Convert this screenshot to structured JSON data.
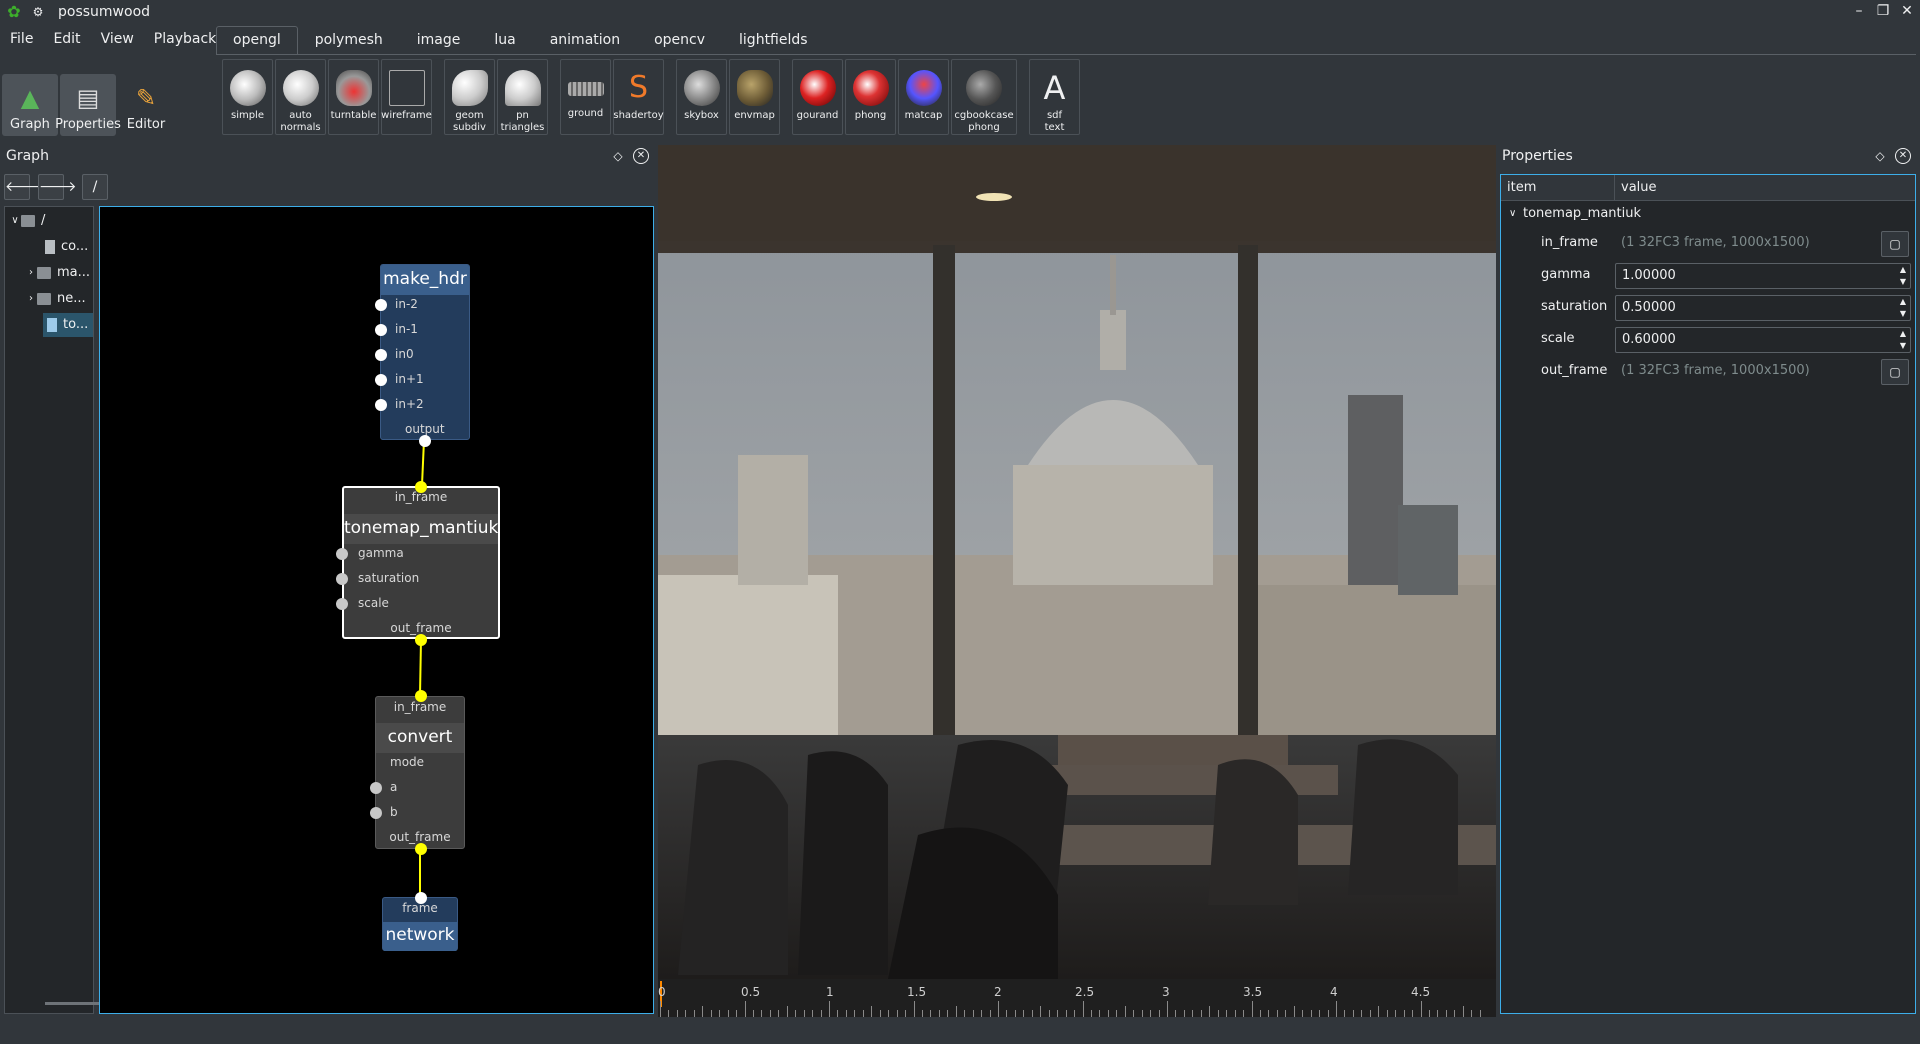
{
  "window": {
    "title": "possumwood"
  },
  "menu": [
    "File",
    "Edit",
    "View",
    "Playback"
  ],
  "left_tools": [
    {
      "label": "Graph",
      "icon": "graph-icon"
    },
    {
      "label": "Properties",
      "icon": "properties-icon"
    },
    {
      "label": "Editor",
      "icon": "editor-icon"
    }
  ],
  "tabs": [
    "opengl",
    "polymesh",
    "image",
    "lua",
    "animation",
    "opencv",
    "lightfields"
  ],
  "toolbar": [
    {
      "label": "simple",
      "icon": "teapot-icon"
    },
    {
      "label": "auto\nnormals",
      "icon": "teapot-icon"
    },
    {
      "label": "turntable",
      "icon": "car-icon"
    },
    {
      "label": "wireframe",
      "icon": "wireframe-cube-icon"
    },
    {
      "label": "geom\nsubdiv",
      "icon": "subdiv-icon"
    },
    {
      "label": "pn\ntriangles",
      "icon": "pn-triangles-icon"
    },
    {
      "label": "ground",
      "icon": "ground-icon"
    },
    {
      "label": "shadertoy",
      "icon": "shadertoy-icon"
    },
    {
      "label": "skybox",
      "icon": "skybox-icon"
    },
    {
      "label": "envmap",
      "icon": "envmap-icon"
    },
    {
      "label": "gourand",
      "icon": "teapot-icon"
    },
    {
      "label": "phong",
      "icon": "teapot-icon"
    },
    {
      "label": "matcap",
      "icon": "matcap-icon"
    },
    {
      "label": "cgbookcase\nphong",
      "icon": "cgbookcase-icon"
    },
    {
      "label": "sdf\ntext",
      "icon": "sdf-text-icon"
    }
  ],
  "graph_panel": {
    "title": "Graph",
    "path": "/",
    "tree": [
      {
        "label": "/",
        "kind": "folder",
        "expanded": true
      },
      {
        "label": "co...",
        "kind": "node"
      },
      {
        "label": "ma...",
        "kind": "folder"
      },
      {
        "label": "ne...",
        "kind": "folder"
      },
      {
        "label": "to...",
        "kind": "node",
        "selected": true
      }
    ]
  },
  "nodes": {
    "make_hdr": {
      "name": "make_hdr",
      "ports": [
        "in-2",
        "in-1",
        "in0",
        "in+1",
        "in+2"
      ],
      "out": "output"
    },
    "tonemap": {
      "name": "tonemap_mantiuk",
      "in": "in_frame",
      "ports": [
        "gamma",
        "saturation",
        "scale"
      ],
      "out": "out_frame"
    },
    "convert": {
      "name": "convert",
      "in": "in_frame",
      "ports": [
        "mode",
        "a",
        "b"
      ],
      "out": "out_frame"
    },
    "network": {
      "name": "network",
      "in": "frame"
    }
  },
  "timeline": {
    "labels": [
      "0",
      "0.5",
      "1",
      "1.5",
      "2",
      "2.5",
      "3",
      "3.5",
      "4",
      "4.5"
    ]
  },
  "properties_panel": {
    "title": "Properties",
    "col_item": "item",
    "col_value": "value",
    "node": "tonemap_mantiuk",
    "rows": [
      {
        "key": "in_frame",
        "value": "(1 32FC3 frame, 1000x1500)",
        "kind": "readonly"
      },
      {
        "key": "gamma",
        "value": "1.00000",
        "kind": "spin"
      },
      {
        "key": "saturation",
        "value": "0.50000",
        "kind": "spin"
      },
      {
        "key": "scale",
        "value": "0.60000",
        "kind": "spin"
      },
      {
        "key": "out_frame",
        "value": "(1 32FC3 frame, 1000x1500)",
        "kind": "readonly"
      }
    ]
  }
}
